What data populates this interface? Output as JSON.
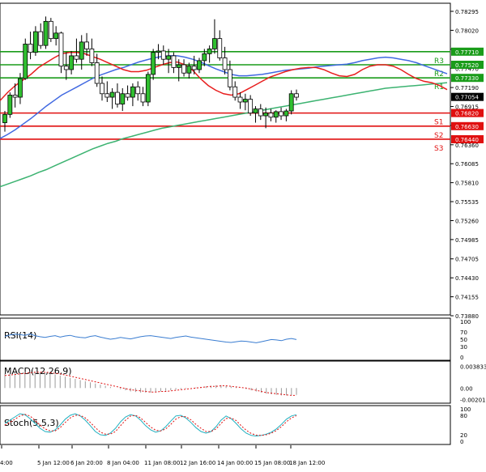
{
  "chart_data": [
    {
      "type": "candlestick",
      "panel": "price",
      "ylim": [
        0.7388,
        0.78295
      ],
      "y_ticks": [
        "0.78295",
        "0.78020",
        "0.77745",
        "0.77470",
        "0.77190",
        "0.76915",
        "0.76640",
        "0.76360",
        "0.76085",
        "0.75810",
        "0.75535",
        "0.75260",
        "0.74985",
        "0.74705",
        "0.74430",
        "0.74155",
        "0.73880"
      ],
      "x_ticks": [
        "4:00",
        "5 Jan 12:00",
        "6 Jan 20:00",
        "8 Jan 04:00",
        "11 Jan 08:00",
        "12 Jan 16:00",
        "14 Jan 00:00",
        "15 Jan 08:00",
        "18 Jan 12:00"
      ],
      "last_price": "0.77054",
      "levels": [
        {
          "name": "R3",
          "value": 0.7771,
          "label": "0.77710",
          "color": "#1a9c1a"
        },
        {
          "name": "R2",
          "value": 0.7752,
          "label": "0.77520",
          "color": "#1a9c1a"
        },
        {
          "name": "R1",
          "value": 0.7733,
          "label": "0.77330",
          "color": "#1a9c1a"
        },
        {
          "name": "S1",
          "value": 0.7682,
          "label": "0.76820",
          "color": "#e01010"
        },
        {
          "name": "S2",
          "value": 0.7663,
          "label": "0.76630",
          "color": "#e01010"
        },
        {
          "name": "S3",
          "value": 0.7644,
          "label": "0.76440",
          "color": "#e01010"
        }
      ],
      "ma_fast": [
        0.77,
        0.7712,
        0.7722,
        0.773,
        0.7738,
        0.7748,
        0.7755,
        0.7762,
        0.7768,
        0.777,
        0.777,
        0.7768,
        0.7764,
        0.776,
        0.7755,
        0.775,
        0.7745,
        0.7742,
        0.7742,
        0.7744,
        0.7748,
        0.7752,
        0.7755,
        0.7756,
        0.7752,
        0.7744,
        0.7732,
        0.7722,
        0.7715,
        0.771,
        0.7708,
        0.771,
        0.7716,
        0.7722,
        0.7728,
        0.7734,
        0.7738,
        0.7742,
        0.7745,
        0.7747,
        0.7748,
        0.7748,
        0.7745,
        0.774,
        0.7736,
        0.7735,
        0.7738,
        0.7745,
        0.775,
        0.7752,
        0.7752,
        0.775,
        0.7745,
        0.7738,
        0.7732,
        0.7728,
        0.7726,
        0.7722,
        0.7716
      ],
      "ma_mid": [
        0.7645,
        0.7651,
        0.7658,
        0.7666,
        0.7674,
        0.7683,
        0.7692,
        0.77,
        0.7708,
        0.7714,
        0.772,
        0.7726,
        0.7732,
        0.7737,
        0.7741,
        0.7745,
        0.7748,
        0.7752,
        0.7756,
        0.7759,
        0.7762,
        0.7764,
        0.7765,
        0.7765,
        0.7763,
        0.776,
        0.7756,
        0.7751,
        0.7746,
        0.7742,
        0.7738,
        0.7736,
        0.7736,
        0.7737,
        0.7738,
        0.774,
        0.7742,
        0.7744,
        0.7745,
        0.7746,
        0.7747,
        0.7749,
        0.775,
        0.7751,
        0.7752,
        0.7753,
        0.7755,
        0.7758,
        0.776,
        0.7762,
        0.7763,
        0.7762,
        0.776,
        0.7758,
        0.7755,
        0.7751,
        0.7747,
        0.7743,
        0.7739
      ],
      "ma_slow": [
        0.7575,
        0.7579,
        0.7583,
        0.7587,
        0.7591,
        0.7596,
        0.76,
        0.7605,
        0.761,
        0.7615,
        0.762,
        0.7625,
        0.763,
        0.7634,
        0.7638,
        0.7641,
        0.7645,
        0.7648,
        0.7651,
        0.7654,
        0.7657,
        0.766,
        0.7662,
        0.7664,
        0.7666,
        0.7668,
        0.767,
        0.7672,
        0.7674,
        0.7676,
        0.7678,
        0.768,
        0.7682,
        0.7684,
        0.7686,
        0.7688,
        0.769,
        0.7692,
        0.7694,
        0.7696,
        0.7698,
        0.77,
        0.7702,
        0.7704,
        0.7706,
        0.7708,
        0.771,
        0.7712,
        0.7714,
        0.7716,
        0.7718,
        0.7719,
        0.772,
        0.7721,
        0.7722,
        0.7723,
        0.7724,
        0.7725,
        0.7726
      ],
      "candles": [
        {
          "o": 0.7668,
          "h": 0.7685,
          "l": 0.7655,
          "c": 0.768
        },
        {
          "o": 0.768,
          "h": 0.7712,
          "l": 0.7675,
          "c": 0.7708
        },
        {
          "o": 0.7708,
          "h": 0.7725,
          "l": 0.769,
          "c": 0.7705
        },
        {
          "o": 0.7705,
          "h": 0.774,
          "l": 0.7695,
          "c": 0.7732
        },
        {
          "o": 0.7732,
          "h": 0.779,
          "l": 0.773,
          "c": 0.7782
        },
        {
          "o": 0.7782,
          "h": 0.78,
          "l": 0.776,
          "c": 0.777
        },
        {
          "o": 0.777,
          "h": 0.7808,
          "l": 0.7765,
          "c": 0.78
        },
        {
          "o": 0.78,
          "h": 0.7812,
          "l": 0.7775,
          "c": 0.778
        },
        {
          "o": 0.778,
          "h": 0.7822,
          "l": 0.7775,
          "c": 0.7815
        },
        {
          "o": 0.7815,
          "h": 0.782,
          "l": 0.7785,
          "c": 0.779
        },
        {
          "o": 0.779,
          "h": 0.7808,
          "l": 0.778,
          "c": 0.7798
        },
        {
          "o": 0.7798,
          "h": 0.78,
          "l": 0.774,
          "c": 0.775
        },
        {
          "o": 0.775,
          "h": 0.777,
          "l": 0.773,
          "c": 0.7745
        },
        {
          "o": 0.7745,
          "h": 0.7772,
          "l": 0.7738,
          "c": 0.7765
        },
        {
          "o": 0.7765,
          "h": 0.779,
          "l": 0.7755,
          "c": 0.776
        },
        {
          "o": 0.776,
          "h": 0.7795,
          "l": 0.7745,
          "c": 0.7785
        },
        {
          "o": 0.7785,
          "h": 0.7798,
          "l": 0.7765,
          "c": 0.7775
        },
        {
          "o": 0.7775,
          "h": 0.779,
          "l": 0.775,
          "c": 0.7755
        },
        {
          "o": 0.7755,
          "h": 0.7768,
          "l": 0.772,
          "c": 0.7725
        },
        {
          "o": 0.7725,
          "h": 0.7735,
          "l": 0.77,
          "c": 0.771
        },
        {
          "o": 0.771,
          "h": 0.7728,
          "l": 0.7698,
          "c": 0.7705
        },
        {
          "o": 0.7705,
          "h": 0.7718,
          "l": 0.7688,
          "c": 0.7712
        },
        {
          "o": 0.7712,
          "h": 0.7725,
          "l": 0.769,
          "c": 0.7695
        },
        {
          "o": 0.7695,
          "h": 0.7718,
          "l": 0.7685,
          "c": 0.771
        },
        {
          "o": 0.771,
          "h": 0.7722,
          "l": 0.77,
          "c": 0.7705
        },
        {
          "o": 0.7705,
          "h": 0.7725,
          "l": 0.7692,
          "c": 0.772
        },
        {
          "o": 0.772,
          "h": 0.7728,
          "l": 0.77,
          "c": 0.771
        },
        {
          "o": 0.771,
          "h": 0.772,
          "l": 0.7692,
          "c": 0.7698
        },
        {
          "o": 0.7698,
          "h": 0.7742,
          "l": 0.7692,
          "c": 0.7738
        },
        {
          "o": 0.7738,
          "h": 0.7775,
          "l": 0.773,
          "c": 0.777
        },
        {
          "o": 0.777,
          "h": 0.7782,
          "l": 0.776,
          "c": 0.7772
        },
        {
          "o": 0.7772,
          "h": 0.778,
          "l": 0.7752,
          "c": 0.776
        },
        {
          "o": 0.776,
          "h": 0.7775,
          "l": 0.774,
          "c": 0.7765
        },
        {
          "o": 0.7765,
          "h": 0.777,
          "l": 0.774,
          "c": 0.7748
        },
        {
          "o": 0.7748,
          "h": 0.776,
          "l": 0.7728,
          "c": 0.7752
        },
        {
          "o": 0.7752,
          "h": 0.776,
          "l": 0.7735,
          "c": 0.774
        },
        {
          "o": 0.774,
          "h": 0.7755,
          "l": 0.7732,
          "c": 0.775
        },
        {
          "o": 0.775,
          "h": 0.7765,
          "l": 0.7738,
          "c": 0.7745
        },
        {
          "o": 0.7745,
          "h": 0.7762,
          "l": 0.774,
          "c": 0.7758
        },
        {
          "o": 0.7758,
          "h": 0.7775,
          "l": 0.775,
          "c": 0.7768
        },
        {
          "o": 0.7768,
          "h": 0.778,
          "l": 0.7755,
          "c": 0.7775
        },
        {
          "o": 0.7775,
          "h": 0.7818,
          "l": 0.7768,
          "c": 0.779
        },
        {
          "o": 0.779,
          "h": 0.7802,
          "l": 0.7758,
          "c": 0.7762
        },
        {
          "o": 0.7762,
          "h": 0.7778,
          "l": 0.7738,
          "c": 0.7745
        },
        {
          "o": 0.7745,
          "h": 0.7758,
          "l": 0.7715,
          "c": 0.772
        },
        {
          "o": 0.772,
          "h": 0.7728,
          "l": 0.77,
          "c": 0.7705
        },
        {
          "o": 0.7705,
          "h": 0.7712,
          "l": 0.7688,
          "c": 0.7698
        },
        {
          "o": 0.7698,
          "h": 0.771,
          "l": 0.7686,
          "c": 0.7702
        },
        {
          "o": 0.7702,
          "h": 0.7708,
          "l": 0.7678,
          "c": 0.7682
        },
        {
          "o": 0.7682,
          "h": 0.7692,
          "l": 0.7668,
          "c": 0.7688
        },
        {
          "o": 0.7688,
          "h": 0.7695,
          "l": 0.7672,
          "c": 0.7678
        },
        {
          "o": 0.7678,
          "h": 0.769,
          "l": 0.766,
          "c": 0.7682
        },
        {
          "o": 0.7682,
          "h": 0.7688,
          "l": 0.767,
          "c": 0.7676
        },
        {
          "o": 0.7676,
          "h": 0.7686,
          "l": 0.7668,
          "c": 0.7684
        },
        {
          "o": 0.7684,
          "h": 0.769,
          "l": 0.7672,
          "c": 0.7678
        },
        {
          "o": 0.7678,
          "h": 0.7688,
          "l": 0.767,
          "c": 0.7685
        },
        {
          "o": 0.7685,
          "h": 0.7715,
          "l": 0.768,
          "c": 0.771
        },
        {
          "o": 0.771,
          "h": 0.7716,
          "l": 0.77,
          "c": 0.7705
        }
      ]
    },
    {
      "type": "line",
      "panel": "rsi",
      "label": "RSI(14)",
      "ylim": [
        0,
        100
      ],
      "y_ticks": [
        "100",
        "70",
        "50",
        "30",
        "0"
      ],
      "values": [
        58,
        62,
        64,
        63,
        61,
        65,
        60,
        57,
        55,
        58,
        60,
        56,
        59,
        61,
        57,
        55,
        54,
        58,
        60,
        56,
        53,
        50,
        52,
        55,
        53,
        51,
        54,
        57,
        59,
        60,
        58,
        56,
        54,
        52,
        55,
        57,
        59,
        56,
        54,
        52,
        50,
        48,
        46,
        44,
        42,
        41,
        43,
        45,
        44,
        42,
        40,
        43,
        46,
        49,
        48,
        46,
        50,
        52,
        49
      ],
      "color": "#3a7dd1"
    },
    {
      "type": "bar",
      "panel": "macd",
      "label": "MACD(12,26,9)",
      "ylim": [
        -0.0021,
        0.0039
      ],
      "y_ticks": [
        "0.003833",
        "0.00",
        "-0.002011"
      ],
      "values": [
        0.0025,
        0.0026,
        0.0027,
        0.0028,
        0.0029,
        0.003,
        0.0029,
        0.0028,
        0.0027,
        0.0026,
        0.0024,
        0.0022,
        0.002,
        0.0018,
        0.0016,
        0.0014,
        0.0012,
        0.001,
        0.0008,
        0.0006,
        0.0004,
        0.0002,
        0.0,
        -0.0002,
        -0.0004,
        -0.0006,
        -0.0007,
        -0.0008,
        -0.0008,
        -0.0008,
        -0.0007,
        -0.0006,
        -0.0005,
        -0.0004,
        -0.0003,
        -0.0002,
        -0.0001,
        0.0,
        0.0001,
        0.0002,
        0.0003,
        0.0004,
        0.0005,
        0.0005,
        0.0004,
        0.0003,
        0.0002,
        0.0,
        -0.0002,
        -0.0004,
        -0.0006,
        -0.0008,
        -0.001,
        -0.0011,
        -0.0012,
        -0.0013,
        -0.0013,
        -0.0013,
        -0.0012
      ],
      "signal": [
        0.0022,
        0.0023,
        0.0024,
        0.0025,
        0.0026,
        0.0027,
        0.0028,
        0.0028,
        0.0028,
        0.0027,
        0.0026,
        0.0025,
        0.0023,
        0.0021,
        0.0019,
        0.0017,
        0.0015,
        0.0013,
        0.0011,
        0.0009,
        0.0007,
        0.0005,
        0.0003,
        0.0001,
        -0.0001,
        -0.0003,
        -0.0004,
        -0.0005,
        -0.0006,
        -0.0007,
        -0.0007,
        -0.0006,
        -0.0006,
        -0.0005,
        -0.0004,
        -0.0003,
        -0.0002,
        -0.0001,
        0.0,
        0.0001,
        0.0002,
        0.0003,
        0.0003,
        0.0004,
        0.0004,
        0.0003,
        0.0002,
        0.0001,
        0.0,
        -0.0002,
        -0.0004,
        -0.0006,
        -0.0008,
        -0.0009,
        -0.001,
        -0.0011,
        -0.0012,
        -0.0013,
        -0.0013
      ],
      "bar_color": "#9a9a9a",
      "signal_color": "#e01010"
    },
    {
      "type": "line",
      "panel": "stoch",
      "label": "Stoch(5,5,3)",
      "ylim": [
        0,
        100
      ],
      "y_ticks": [
        "100",
        "80",
        "20",
        "0"
      ],
      "series": [
        {
          "values": [
            55,
            65,
            75,
            85,
            82,
            70,
            55,
            40,
            30,
            28,
            35,
            50,
            68,
            80,
            85,
            78,
            65,
            48,
            30,
            20,
            18,
            25,
            40,
            60,
            75,
            82,
            78,
            65,
            48,
            35,
            28,
            32,
            45,
            62,
            78,
            80,
            72,
            58,
            42,
            30,
            25,
            30,
            45,
            65,
            78,
            70,
            55,
            38,
            25,
            18,
            16,
            18,
            22,
            28,
            38,
            52,
            68,
            78,
            82
          ]
        },
        {
          "values": [
            50,
            58,
            68,
            78,
            83,
            78,
            65,
            50,
            38,
            32,
            32,
            42,
            58,
            72,
            80,
            80,
            72,
            58,
            42,
            28,
            22,
            22,
            30,
            48,
            65,
            78,
            80,
            72,
            58,
            44,
            34,
            32,
            38,
            52,
            68,
            76,
            76,
            66,
            52,
            40,
            30,
            30,
            38,
            55,
            70,
            72,
            64,
            48,
            34,
            24,
            19,
            18,
            20,
            25,
            33,
            45,
            60,
            72,
            79
          ]
        }
      ],
      "series_colors": [
        "#20b0c0",
        "#e01010"
      ]
    }
  ]
}
